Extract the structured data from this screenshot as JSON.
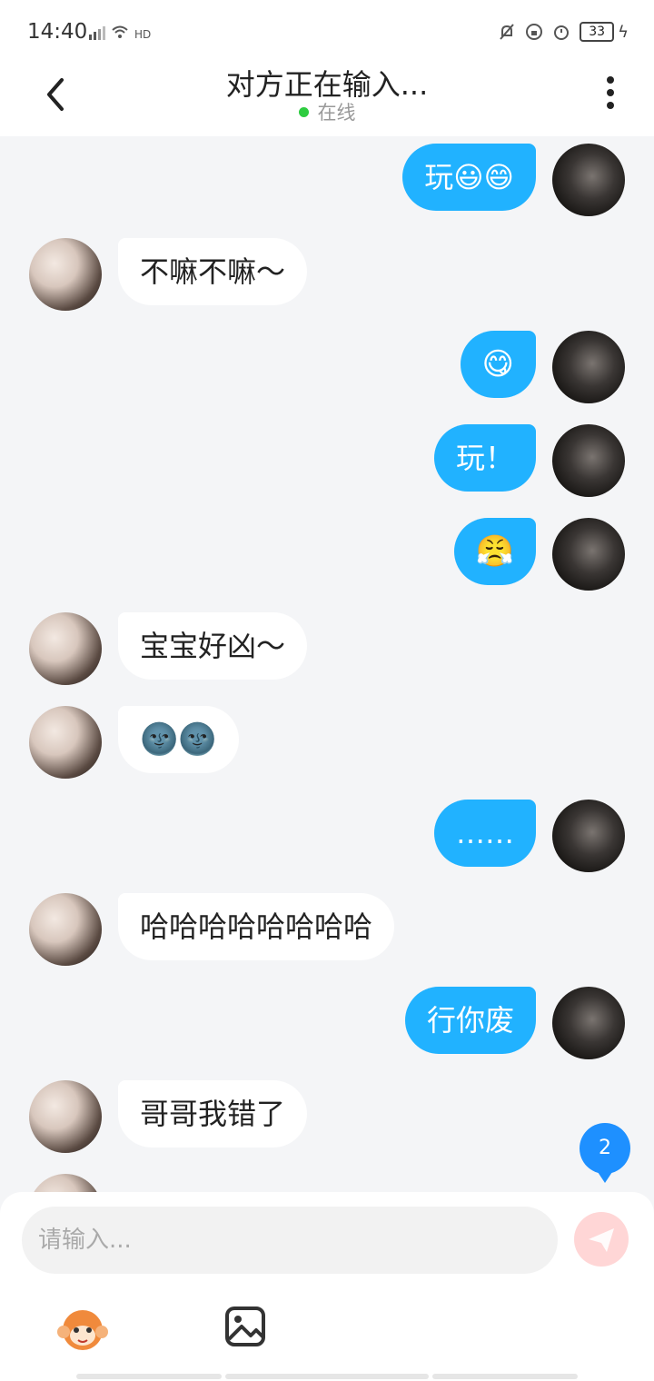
{
  "status_bar": {
    "time": "14:40",
    "battery": "33"
  },
  "header": {
    "title": "对方正在输入...",
    "status": "在线"
  },
  "messages": [
    {
      "side": "right",
      "text": "玩😃😄"
    },
    {
      "side": "left",
      "text": "不嘛不嘛～"
    },
    {
      "side": "right",
      "text": "😋"
    },
    {
      "side": "right",
      "text": "玩！"
    },
    {
      "side": "right",
      "text": "😤"
    },
    {
      "side": "left",
      "text": "宝宝好凶～"
    },
    {
      "side": "left",
      "text": "🌚🌚"
    },
    {
      "side": "right",
      "text": "……"
    },
    {
      "side": "left",
      "text": "哈哈哈哈哈哈哈哈"
    },
    {
      "side": "right",
      "text": "行你废"
    },
    {
      "side": "left",
      "text": "哥哥我错了"
    }
  ],
  "new_badge": "2",
  "composer": {
    "placeholder": "请输入..."
  },
  "colors": {
    "accent": "#21b2ff",
    "online": "#2ecc40",
    "badge": "#1e90ff"
  }
}
